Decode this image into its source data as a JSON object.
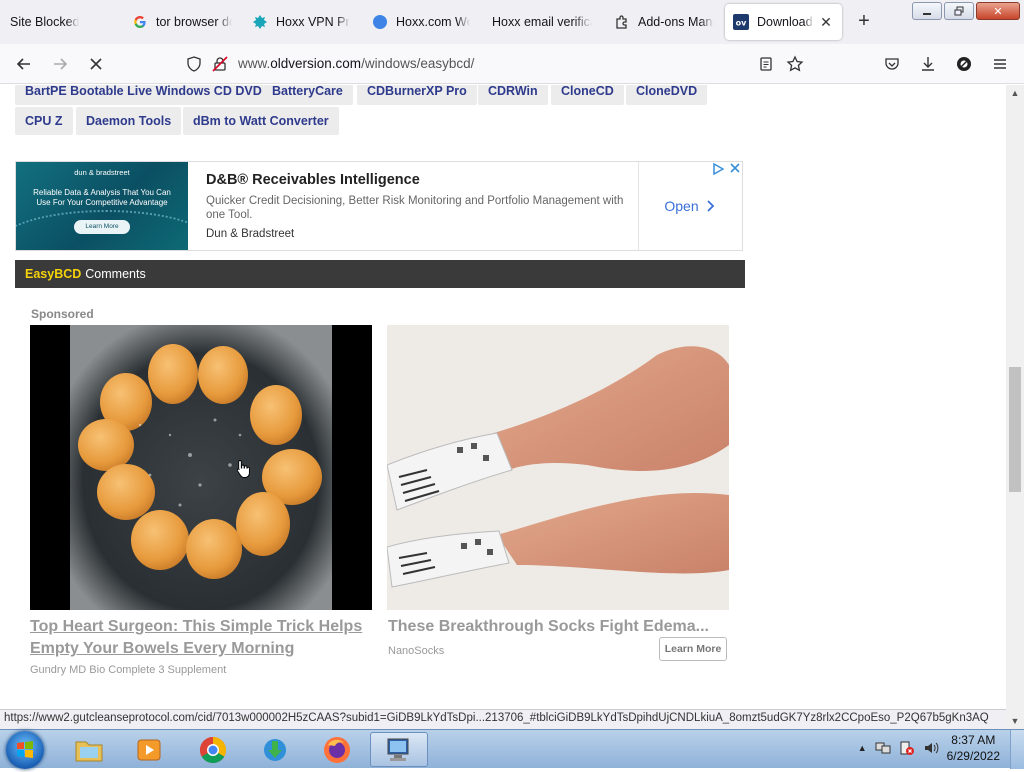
{
  "browser": {
    "tabs": [
      {
        "label": "Site Blocked",
        "icon": "none"
      },
      {
        "label": "tor browser do",
        "icon": "google-icon"
      },
      {
        "label": "Hoxx VPN Prox",
        "icon": "hoxx-icon"
      },
      {
        "label": "Hoxx.com Wel",
        "icon": "globe-icon"
      },
      {
        "label": "Hoxx email verifica",
        "icon": "none"
      },
      {
        "label": "Add-ons Mana",
        "icon": "puzzle-icon"
      },
      {
        "label": "Download O",
        "icon": "oldversion-icon",
        "active": true
      }
    ],
    "url_prefix": "www.",
    "url_domain": "oldversion.com",
    "url_path": "/windows/easybcd/"
  },
  "page": {
    "related_links": [
      "BartPE Bootable Live Windows CD DVD",
      "BatteryCare",
      "CDBurnerXP Pro",
      "CDRWin",
      "CloneCD",
      "CloneDVD",
      "CPU Z",
      "Daemon Tools",
      "dBm to Watt Converter"
    ],
    "ad": {
      "image_brand": "dun & bradstreet",
      "image_tagline": "Reliable Data & Analysis That You Can Use For Your Competitive Advantage",
      "image_cta": "Learn More",
      "title": "D&B® Receivables Intelligence",
      "description": "Quicker Credit Decisioning, Better Risk Monitoring and Portfolio Management with one Tool.",
      "advertiser": "Dun & Bradstreet",
      "open_label": "Open"
    },
    "comments_header": {
      "highlight": "EasyBCD",
      "rest": "Comments"
    },
    "sponsored_label": "Sponsored",
    "cards": [
      {
        "title": "Top Heart Surgeon: This Simple Trick Helps Empty Your Bowels Every Morning",
        "source": "Gundry MD Bio Complete 3 Supplement"
      },
      {
        "title": "These Breakthrough Socks Fight Edema...",
        "source": "NanoSocks",
        "button": "Learn More"
      }
    ]
  },
  "status_url": "https://www2.gutcleanseprotocol.com/cid/7013w000002H5zCAAS?subid1=GiDB9LkYdTsDpi...213706_#tblciGiDB9LkYdTsDpihdUjCNDLkiuA_8omzt5udGK7Yz8rlx2CCpoEso_P2Q67b5gKn3AQ",
  "taskbar": {
    "time": "8:37 AM",
    "date": "6/29/2022"
  }
}
